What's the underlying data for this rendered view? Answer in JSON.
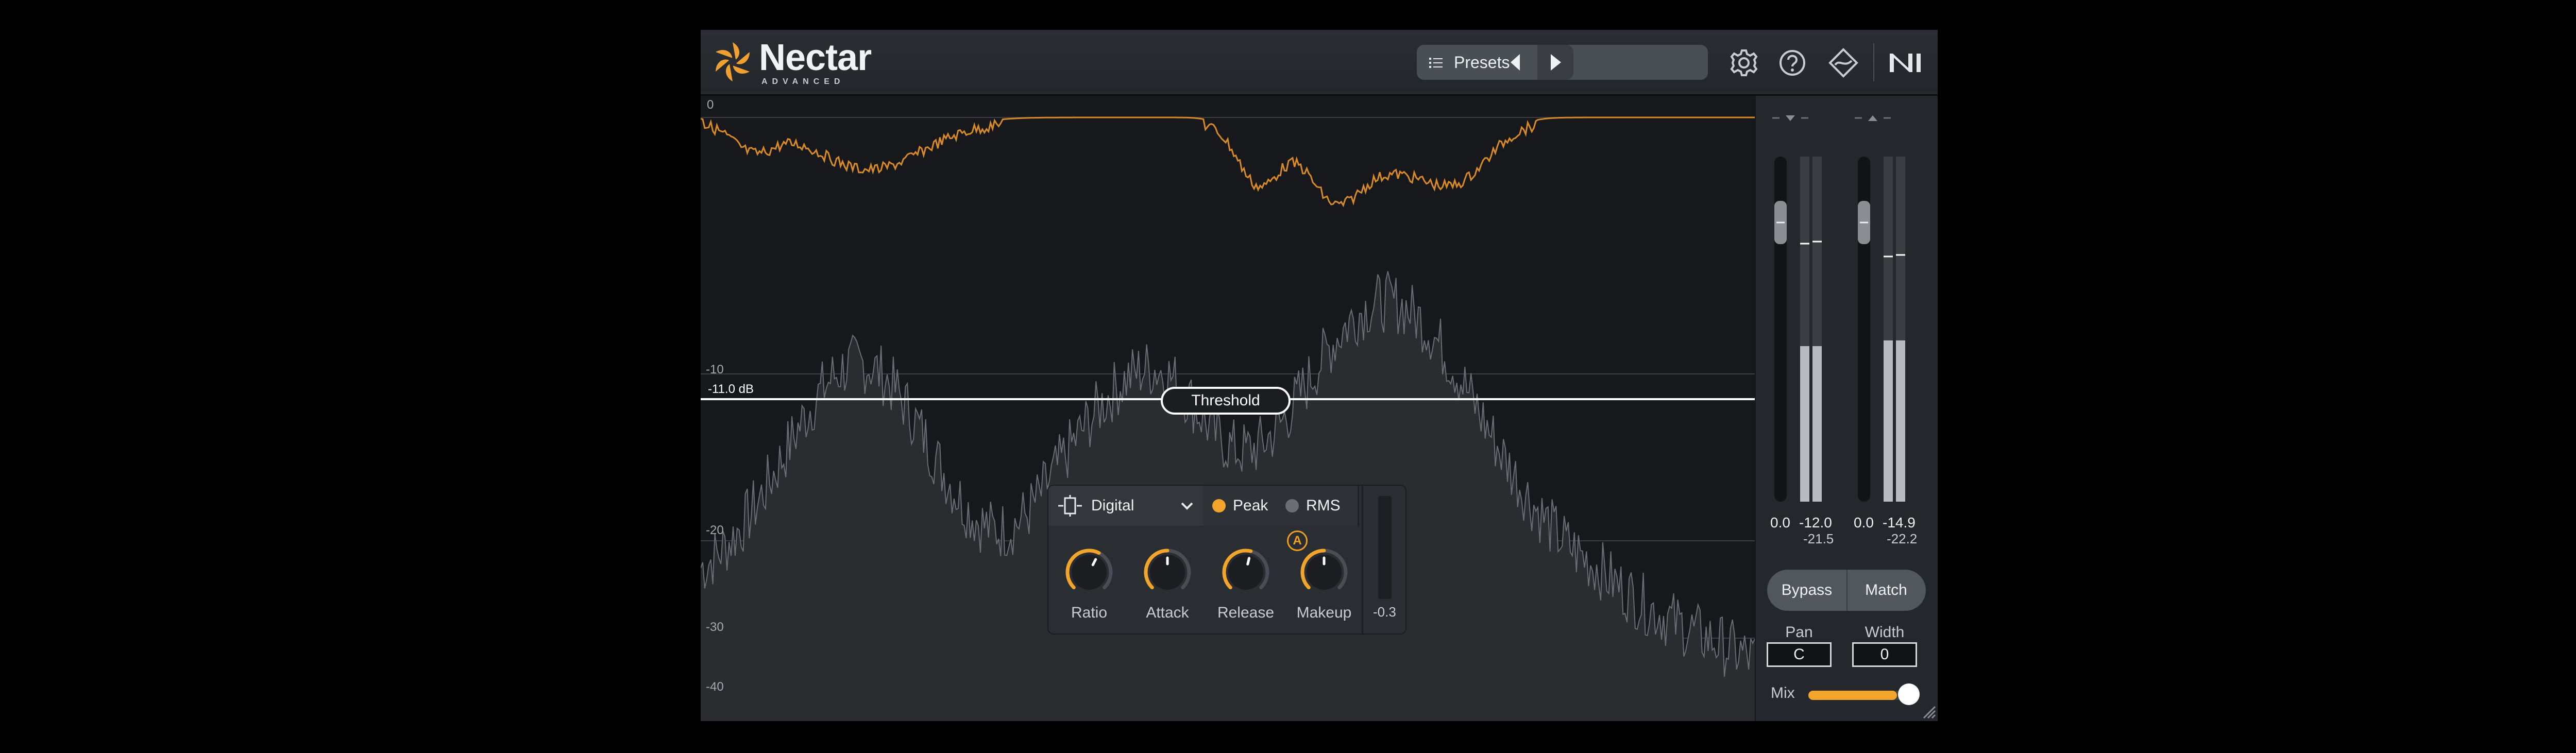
{
  "header": {
    "logo_name": "Nectar",
    "logo_sub": "ADVANCED",
    "presets_label": "Presets",
    "icons": [
      "list-icon",
      "prev-preset-icon",
      "next-preset-icon",
      "gear-icon",
      "help-icon",
      "ozone-link-icon",
      "ni-logo-icon"
    ]
  },
  "graph": {
    "y_labels": [
      "0",
      "-10",
      "-20",
      "-30",
      "-40"
    ],
    "threshold_value": "-11.0 dB",
    "threshold_label": "Threshold"
  },
  "compressor": {
    "mode": "Digital",
    "detection": {
      "peak": "Peak",
      "rms": "RMS",
      "selected": "Peak"
    },
    "knobs": [
      {
        "label": "Ratio",
        "value": 0.6
      },
      {
        "label": "Attack",
        "value": 0.5
      },
      {
        "label": "Release",
        "value": 0.55
      },
      {
        "label": "Makeup",
        "value": 0.5
      }
    ],
    "auto_badge": "A",
    "gain_reduction": "-0.3"
  },
  "meters": {
    "input_fader": "0.0",
    "input_peak": "-12.0",
    "input_rms": "-21.5",
    "output_fader": "0.0",
    "output_peak": "-14.9",
    "output_rms": "-22.2"
  },
  "controls": {
    "bypass": "Bypass",
    "match": "Match",
    "pan_label": "Pan",
    "pan_value": "C",
    "width_label": "Width",
    "width_value": "0",
    "mix_label": "Mix",
    "mix_fraction": 0.85
  },
  "colors": {
    "accent": "#f2a52a",
    "background": "#16181b",
    "waveform": "#5a5d62"
  }
}
